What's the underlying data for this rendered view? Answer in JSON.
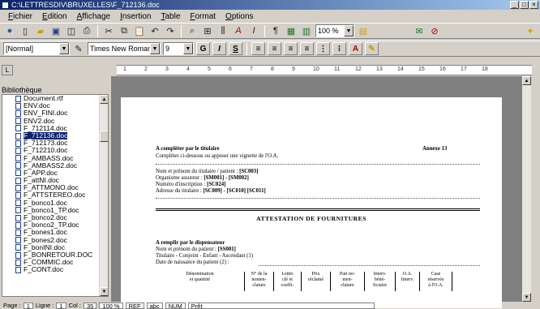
{
  "window": {
    "title": "C:\\LETTRESDIV\\BRUXELLES\\F_712136.doc"
  },
  "menu": [
    "Fichier",
    "Edition",
    "Affichage",
    "Insertion",
    "Table",
    "Format",
    "Options"
  ],
  "toolbar": {
    "zoom": "100 %"
  },
  "format": {
    "style": "[Normal]",
    "font": "Times New Roman",
    "size": "9"
  },
  "ruler": [
    "1",
    "2",
    "3",
    "4",
    "5",
    "6",
    "7",
    "8",
    "9",
    "10",
    "11",
    "12",
    "13",
    "14",
    "15",
    "16",
    "17",
    "18"
  ],
  "sidebar": {
    "title": "Bibliothèque",
    "items": [
      "Document.rtf",
      "ENV.doc",
      "ENV_FINI.doc",
      "ENV2.doc",
      "F_712114.doc",
      "F_712136.doc",
      "F_712173.doc",
      "F_712210.doc",
      "F_AMBASS.doc",
      "F_AMBASS2.doc",
      "F_APP.doc",
      "F_attNI.doc",
      "F_ATTMONO.doc",
      "F_ATTSTEREO.doc",
      "F_bonco1.doc",
      "F_bonco1_TP.doc",
      "F_bonco2.doc",
      "F_bonco2_TP.doc",
      "F_bones1.doc",
      "F_bones2.doc",
      "F_bonINI.doc",
      "F_BONRETOUR.DOC",
      "F_COMMIC.doc",
      "F_CONT.doc"
    ],
    "selected_index": 5
  },
  "document": {
    "to_complete": "A compléter par le titulaire",
    "annexe": "Annexe 13",
    "vignette": "Compléter ci-dessous ou apposer une vignette de l'O.A.",
    "name_label": "Nom et prénom du titulaire / patient : ",
    "name_val": "[SC003]",
    "org_label": "Organisme assureur : ",
    "org_val": "[SM001] - [SM002]",
    "reg_label": "Numéro d'inscription : ",
    "reg_val": "[SC024]",
    "addr_label": "Adresse du titulaire : ",
    "addr_val": "[SC009] - [SC010] [SC011]",
    "attestation": "ATTESTATION DE FOURNITURES",
    "dispenser": "A remplir par le dispensateur",
    "patient_label": "Nom et prénom du patient : ",
    "patient_val": "[SS001]",
    "titulaire": "Titulaire - Conjoint - Enfant - Ascendant (1)",
    "birth": "Date de naissance du patient (2) :",
    "columns": [
      "Dénomination\net quantité",
      "N° de la\nnomen-\nclature",
      "Lettre\nclé et\ncoeffi-",
      "Prix\nréclamé",
      "Part no-\nmen-\nclature",
      "Interv.\nbéné-\nficiaire",
      "O.A.\nInterv.",
      "Case\nréservée\nà l'O.A."
    ]
  },
  "status": {
    "page_label": "Page :",
    "page": "1",
    "line_label": "Ligne :",
    "line": "1",
    "col_label": "Col :",
    "col": "35",
    "zoom": "100 %",
    "ref": "REF",
    "abc": "abc",
    "num": "NUM",
    "ready": "Prêt"
  }
}
